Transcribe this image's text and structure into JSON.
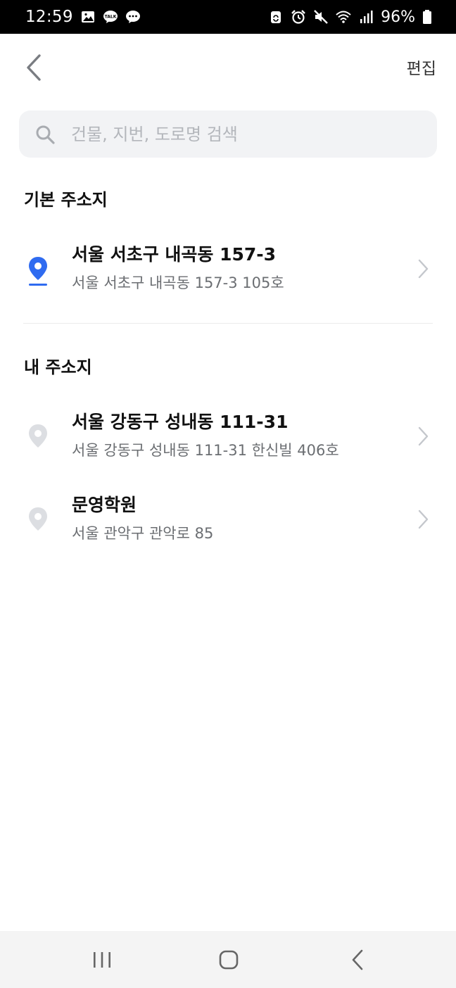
{
  "status_bar": {
    "time": "12:59",
    "battery": "96%",
    "left_icons": [
      "gallery-icon",
      "kakaotalk-icon",
      "chat-icon"
    ],
    "kakao_label": "TALK",
    "right_icons": [
      "recycle-icon",
      "alarm-icon",
      "mute-icon",
      "wifi-icon",
      "signal-icon",
      "battery-icon"
    ]
  },
  "app_bar": {
    "edit_label": "편집"
  },
  "search": {
    "placeholder": "건물, 지번, 도로명 검색"
  },
  "default_section": {
    "title": "기본 주소지",
    "item": {
      "title": "서울 서초구 내곡동 157-3",
      "detail": "서울 서초구 내곡동 157-3 105호",
      "pin_color": "#2f6bf0"
    }
  },
  "my_section": {
    "title": "내 주소지",
    "items": [
      {
        "title": "서울 강동구 성내동 111-31",
        "detail": "서울 강동구 성내동 111-31 한신빌 406호"
      },
      {
        "title": "문영학원",
        "detail": "서울 관악구 관악로 85"
      }
    ]
  },
  "colors": {
    "accent": "#2f6bf0",
    "pin_inactive": "#dcdee2",
    "chevron": "#c4c7cc",
    "search_bg": "#f2f3f5"
  }
}
